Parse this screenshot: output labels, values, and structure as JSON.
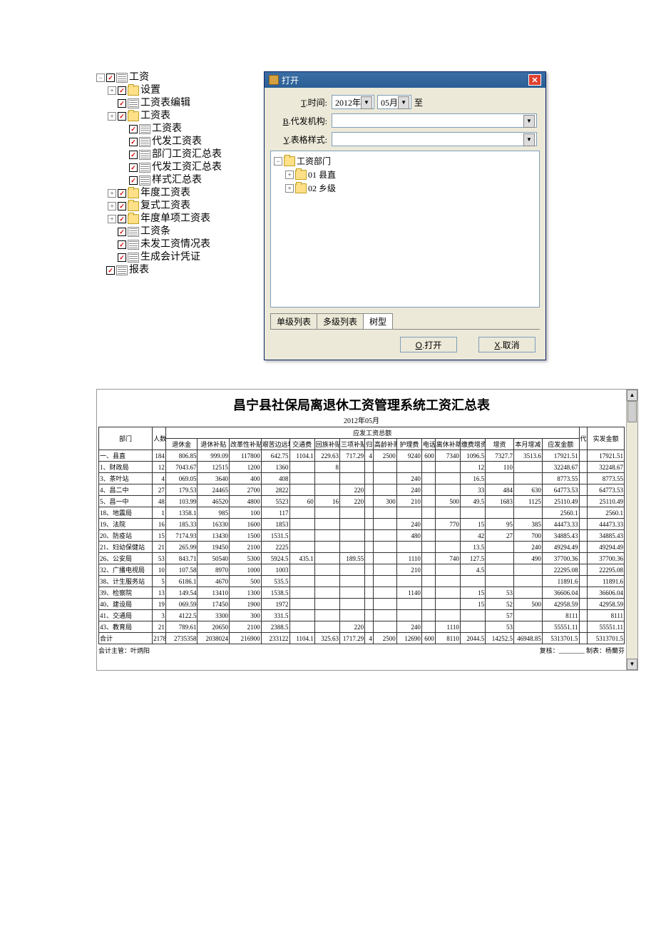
{
  "tree": {
    "root": "工资",
    "items": [
      {
        "label": "设置",
        "folder": true,
        "expand": true
      },
      {
        "label": "工资表编辑",
        "folder": false
      },
      {
        "label": "工资表",
        "folder": true,
        "expand": true,
        "children": [
          {
            "label": "工资表"
          },
          {
            "label": "代发工资表"
          },
          {
            "label": "部门工资汇总表"
          },
          {
            "label": "代发工资汇总表"
          },
          {
            "label": "样式汇总表"
          }
        ]
      },
      {
        "label": "年度工资表",
        "folder": true,
        "expand": true
      },
      {
        "label": "复式工资表",
        "folder": true,
        "expand": true
      },
      {
        "label": "年度单项工资表",
        "folder": true,
        "expand": true
      },
      {
        "label": "工资条",
        "folder": false
      },
      {
        "label": "未发工资情况表",
        "folder": false
      },
      {
        "label": "生成会计凭证",
        "folder": false
      },
      {
        "label": "报表",
        "folder": false,
        "outdent": true
      }
    ]
  },
  "dialog": {
    "title": "打开",
    "time_label": "T.时间:",
    "year": "2012年",
    "month": "05月",
    "to": "至",
    "bank_label": "B.代发机构:",
    "style_label": "Y.表格样式:",
    "dept_root": "工资部门",
    "dept_children": [
      {
        "code": "01",
        "name": "县直"
      },
      {
        "code": "02",
        "name": "乡级"
      }
    ],
    "tabs": [
      "单级列表",
      "多级列表",
      "树型"
    ],
    "ok": "O.打开",
    "cancel": "X.取消"
  },
  "report": {
    "title": "昌宁县社保局离退休工资管理系统工资汇总表",
    "date": "2012年05月",
    "group_header": "应发工资总额",
    "cols": [
      "部门",
      "人数",
      "退休金",
      "退休补贴",
      "改革性补贴",
      "艰苦边远地区补贴",
      "交通费",
      "回族补贴",
      "三项补贴",
      "归",
      "高龄补贴",
      "护理费",
      "电话",
      "离休补助",
      "缴费增资",
      "增资",
      "本月增减",
      "应发金额",
      "代",
      "实发金额"
    ],
    "rows": [
      [
        "一、县直",
        "184",
        "806.85",
        "999.09",
        "117800",
        "642.75",
        "1104.1",
        "229.63",
        "717.29",
        "4",
        "2500",
        "9240",
        "600",
        "7340",
        "1096.5",
        "7327.7",
        "3513.6",
        "17921.51",
        "",
        "17921.51"
      ],
      [
        "1、财政局",
        "12",
        "7043.67",
        "12515",
        "1200",
        "1360",
        "",
        "8",
        "",
        "",
        "",
        "",
        "",
        "",
        "12",
        "110",
        "",
        "32248.67",
        "",
        "32248.67"
      ],
      [
        "3、茶叶站",
        "4",
        "069.05",
        "3640",
        "400",
        "408",
        "",
        "",
        "",
        "",
        "",
        "240",
        "",
        "",
        "16.5",
        "",
        "",
        "8773.55",
        "",
        "8773.55"
      ],
      [
        "4、昌二中",
        "27",
        "179.53",
        "24465",
        "2700",
        "2822",
        "",
        "",
        "220",
        "",
        "",
        "240",
        "",
        "",
        "33",
        "484",
        "630",
        "64773.53",
        "",
        "64773.53"
      ],
      [
        "5、昌一中",
        "48",
        "103.99",
        "46520",
        "4800",
        "5523",
        "60",
        "16",
        "220",
        "",
        "300",
        "210",
        "",
        "500",
        "49.5",
        "1683",
        "1125",
        "25110.49",
        "",
        "25110.49"
      ],
      [
        "18、地震局",
        "1",
        "1358.1",
        "985",
        "100",
        "117",
        "",
        "",
        "",
        "",
        "",
        "",
        "",
        "",
        "",
        "",
        "",
        "2560.1",
        "",
        "2560.1"
      ],
      [
        "19、法院",
        "16",
        "185.33",
        "16330",
        "1600",
        "1853",
        "",
        "",
        "",
        "",
        "",
        "240",
        "",
        "770",
        "15",
        "95",
        "385",
        "44473.33",
        "",
        "44473.33"
      ],
      [
        "20、防疫站",
        "15",
        "7174.93",
        "13430",
        "1500",
        "1531.5",
        "",
        "",
        "",
        "",
        "",
        "480",
        "",
        "",
        "42",
        "27",
        "700",
        "34885.43",
        "",
        "34885.43"
      ],
      [
        "21、妇幼保健站",
        "21",
        "265.99",
        "19450",
        "2100",
        "2225",
        "",
        "",
        "",
        "",
        "",
        "",
        "",
        "",
        "13.5",
        "",
        "240",
        "49294.49",
        "",
        "49294.49"
      ],
      [
        "26、公安局",
        "53",
        "843.71",
        "50540",
        "5300",
        "5924.5",
        "435.1",
        "",
        "189.55",
        "",
        "",
        "1110",
        "",
        "740",
        "127.5",
        "",
        "490",
        "37700.36",
        "",
        "37700.36"
      ],
      [
        "32、广播电视局",
        "10",
        "107.58",
        "8970",
        "1000",
        "1003",
        "",
        "",
        "",
        "",
        "",
        "210",
        "",
        "",
        "4.5",
        "",
        "",
        "22295.08",
        "",
        "22295.08"
      ],
      [
        "38、计生服务站",
        "5",
        "6186.1",
        "4670",
        "500",
        "535.5",
        "",
        "",
        "",
        "",
        "",
        "",
        "",
        "",
        "",
        "",
        "",
        "11891.6",
        "",
        "11891.6"
      ],
      [
        "39、检察院",
        "13",
        "149.54",
        "13410",
        "1300",
        "1538.5",
        "",
        "",
        "",
        "",
        "",
        "1140",
        "",
        "",
        "15",
        "53",
        "",
        "36606.04",
        "",
        "36606.04"
      ],
      [
        "40、建设局",
        "19",
        "069.59",
        "17450",
        "1900",
        "1972",
        "",
        "",
        "",
        "",
        "",
        "",
        "",
        "",
        "15",
        "52",
        "500",
        "42958.59",
        "",
        "42958.59"
      ],
      [
        "41、交通局",
        "3",
        "4122.5",
        "3300",
        "300",
        "331.5",
        "",
        "",
        "",
        "",
        "",
        "",
        "",
        "",
        "",
        "57",
        "",
        "8111",
        "",
        "8111"
      ],
      [
        "43、教育局",
        "21",
        "789.61",
        "20650",
        "2100",
        "2388.5",
        "",
        "",
        "220",
        "",
        "",
        "240",
        "",
        "1110",
        "",
        "53",
        "",
        "55551.11",
        "",
        "55551.11"
      ],
      [
        "合计",
        "2178",
        "2735358",
        "2038024",
        "216900",
        "233122",
        "1104.1",
        "325.63",
        "1717.29",
        "4",
        "2500",
        "12690",
        "600",
        "8110",
        "2044.5",
        "14252.5",
        "46948.85",
        "5313701.5",
        "",
        "5313701.5"
      ]
    ],
    "footer_left": "会计主管：叶炳阳",
    "footer_right": "复核：________  制表：杨蘭芬"
  }
}
